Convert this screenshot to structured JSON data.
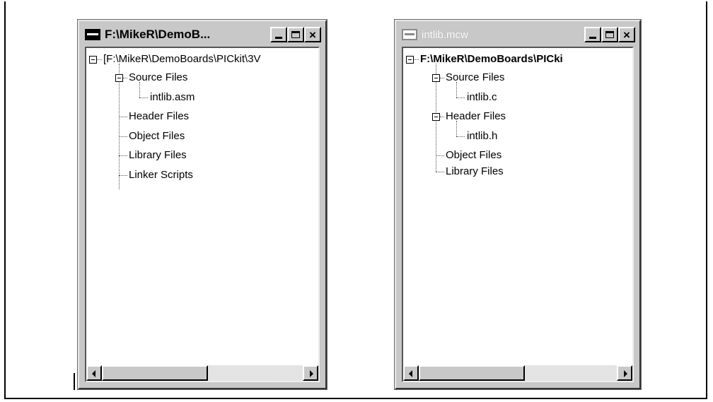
{
  "window1": {
    "title": "F:\\MikeR\\DemoB...",
    "state": "active",
    "tree": {
      "root": "[F:\\MikeR\\DemoBoards\\PICkit\\3V",
      "source_files": "Source Files",
      "source_child": "intlib.asm",
      "header_files": "Header Files",
      "object_files": "Object Files",
      "library_files": "Library Files",
      "linker_scripts": "Linker Scripts"
    }
  },
  "window2": {
    "title": "intlib.mcw",
    "state": "inactive",
    "tree": {
      "root": "F:\\MikeR\\DemoBoards\\PICki",
      "source_files": "Source Files",
      "source_child": "intlib.c",
      "header_files": "Header Files",
      "header_child": "intlib.h",
      "object_files": "Object Files",
      "library_files": "Library Files"
    }
  },
  "icons": [
    "system-menu-icon",
    "minimize-icon",
    "maximize-icon",
    "close-icon",
    "collapse-icon",
    "scroll-left-icon",
    "scroll-right-icon"
  ]
}
